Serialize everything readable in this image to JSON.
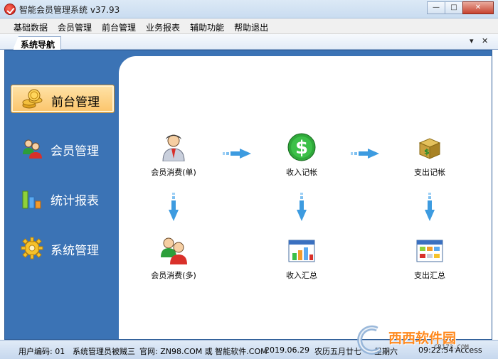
{
  "window": {
    "title": "智能会员管理系统 v37.93",
    "minimize": "—",
    "maximize": "□",
    "close": "✕"
  },
  "menu": [
    "基础数据",
    "会员管理",
    "前台管理",
    "业务报表",
    "辅助功能",
    "帮助退出"
  ],
  "tab": {
    "label": "系统导航",
    "dropdown": "▾",
    "close": "✕"
  },
  "sidebar": {
    "items": [
      {
        "label": "前台管理",
        "icon": "coins-icon",
        "active": true
      },
      {
        "label": "会员管理",
        "icon": "members-icon",
        "active": false
      },
      {
        "label": "统计报表",
        "icon": "bar-chart-icon",
        "active": false
      },
      {
        "label": "系统管理",
        "icon": "gear-icon",
        "active": false
      }
    ]
  },
  "flow": {
    "nodes": [
      {
        "label": "会员消费(单)",
        "icon": "member-icon"
      },
      {
        "label": "收入记帐",
        "icon": "dollar-icon"
      },
      {
        "label": "支出记帐",
        "icon": "money-box-icon"
      },
      {
        "label": "会员消费(多)",
        "icon": "members-icon"
      },
      {
        "label": "收入汇总",
        "icon": "income-chart-icon"
      },
      {
        "label": "支出汇总",
        "icon": "expense-table-icon"
      }
    ]
  },
  "status": {
    "user_code": "用户编码: 01",
    "user_role": "系统管理员被贼三",
    "website": "官网: ZN98.COM 或 智能软件.COM",
    "date": "2019.06.29",
    "lunar": "农历五月廿七",
    "weekday": "星期六",
    "time": "09:22:54",
    "db": "Access"
  },
  "watermark": {
    "text": "西西软件园",
    "sub": "CR173.COM"
  },
  "colors": {
    "sidebar_bg": "#3b73b5",
    "active_item": "#fbc46a",
    "arrow": "#3d9be0"
  }
}
